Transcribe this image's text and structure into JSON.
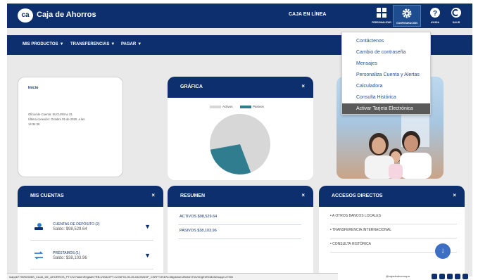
{
  "header": {
    "logo_mark": "ca",
    "brand": "Caja de Ahorros",
    "online_label": "CAJA EN LÍNEA",
    "buttons": [
      {
        "label": "PERSONALIZAR",
        "icon": "grid-icon"
      },
      {
        "label": "CONFIGURACIÓN",
        "icon": "gear-icon"
      },
      {
        "label": "AYUDA",
        "icon": "help-icon"
      },
      {
        "label": "SALIR",
        "icon": "logout-icon"
      }
    ]
  },
  "nav": {
    "items": [
      "MIS PRODUCTOS",
      "TRANSFERENCIAS",
      "PAGAR"
    ],
    "caret": "▼"
  },
  "settings_menu": {
    "items": [
      "Contáctenos",
      "Cambio de contraseña",
      "Mensajes",
      "Personaliza Cuenta y Alertas",
      "Calculadora",
      "Consulta Histórica",
      "Activar Tarjeta Electrónica"
    ],
    "highlighted": "Activar Tarjeta Electrónica"
  },
  "welcome": {
    "title": "Inicio",
    "lines": [
      "Oficial de Cuenta: SUCURSAL 01",
      "Última conexión: Octubre 05 de 2020, a las",
      "14:34:36"
    ]
  },
  "grafica": {
    "title": "GRÁFICA",
    "close": "×"
  },
  "chart_data": {
    "type": "pie",
    "labels": [
      "Activos",
      "Pasivos"
    ],
    "values": [
      98529.64,
      38103.96
    ],
    "colors": [
      "#d7d7d7",
      "#2f7d8f"
    ],
    "legend": "top"
  },
  "mis_cuentas": {
    "title": "MIS CUENTAS",
    "close": "×",
    "rows": [
      {
        "name": "CUENTAS DE DEPÓSITO (2)",
        "balance": "Saldo: $98,529.64"
      },
      {
        "name": "PRÉSTAMOS (1)",
        "balance": "Saldo: $38,103.96"
      }
    ],
    "arrow": "▼"
  },
  "resumen": {
    "title": "RESUMEN",
    "close": "×",
    "rows": [
      "ACTIVOS $98,529.64",
      "PASIVOS $38,103.96"
    ]
  },
  "accesos": {
    "title": "ACCESOS DIRECTOS",
    "close": "×",
    "items": [
      "A OTROS BANCOS LOCALES",
      "TRANSFERENCIA INTERNACIONAL",
      "CONSULTA HISTÓRICA"
    ],
    "bullet": "•"
  },
  "fab": {
    "icon": "arrow-down-icon",
    "glyph": "↓"
  },
  "status": {
    "url": "loapp6779090/DIBS_CAJA_DE_AHORROS_PTY/UI?tokenRegister?RB=200&OPT=CONFIG-90-25-0&OWASP_CSRFTOKEN=08gdolue18fmtsf1Tbh/hOgEeRO8282/oapp=z790e",
    "handle": "@cajadeahorrospa"
  },
  "colors": {
    "primary": "#0d2f6e",
    "accent": "#2f7d8f",
    "highlight": "#5a5a5a"
  }
}
